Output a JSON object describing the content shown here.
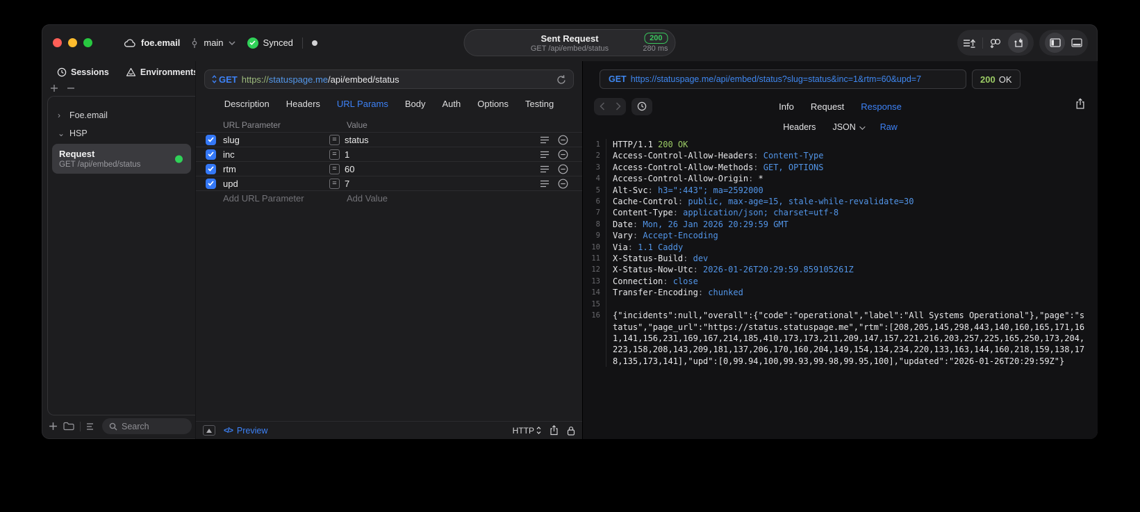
{
  "titlebar": {
    "project": "foe.email",
    "branch": "main",
    "sync_status": "Synced",
    "request_title": "Sent Request",
    "request_subtitle": "GET /api/embed/status",
    "status_code": "200",
    "duration": "280 ms"
  },
  "sidebar": {
    "tabs": [
      {
        "label": "Sessions",
        "active": true
      },
      {
        "label": "Environments"
      }
    ],
    "tree": [
      {
        "chevron": "›",
        "label": "Foe.email"
      },
      {
        "chevron": "⌄",
        "label": "HSP"
      }
    ],
    "request_item": {
      "title": "Request",
      "subtitle": "GET /api/embed/status"
    },
    "search_placeholder": "Search"
  },
  "request_panel": {
    "method": "GET",
    "url_scheme": "https://",
    "url_host": "statuspage.me",
    "url_path": "/api/embed/status",
    "tabs": [
      {
        "label": "Description"
      },
      {
        "label": "Headers"
      },
      {
        "label": "URL Params",
        "active": true
      },
      {
        "label": "Body"
      },
      {
        "label": "Auth"
      },
      {
        "label": "Options"
      },
      {
        "label": "Testing"
      }
    ],
    "param_table": {
      "col_name": "URL Parameter",
      "col_value": "Value",
      "match_symbol": "=",
      "rows": [
        {
          "name": "slug",
          "value": "status",
          "enabled": true
        },
        {
          "name": "inc",
          "value": "1",
          "enabled": true
        },
        {
          "name": "rtm",
          "value": "60",
          "enabled": true
        },
        {
          "name": "upd",
          "value": "7",
          "enabled": true
        }
      ],
      "add_name_placeholder": "Add URL Parameter",
      "add_value_placeholder": "Add Value"
    },
    "footer": {
      "code_symbol": "</>",
      "preview_label": "Preview",
      "protocol": "HTTP"
    }
  },
  "response_panel": {
    "method": "GET",
    "url": "https://statuspage.me/api/embed/status?slug=status&inc=1&rtm=60&upd=7",
    "status_code": "200",
    "status_text": "OK",
    "tabs": [
      {
        "label": "Info"
      },
      {
        "label": "Request"
      },
      {
        "label": "Response",
        "active": true
      }
    ],
    "subtabs": [
      {
        "label": "Headers"
      },
      {
        "label": "JSON",
        "dropdown": true
      },
      {
        "label": "Raw",
        "active": true
      }
    ],
    "code_lines": [
      {
        "num": 1,
        "name": "HTTP/1.1",
        "sep": " ",
        "value": "200 OK",
        "value_class": "green"
      },
      {
        "num": 2,
        "name": "Access-Control-Allow-Headers",
        "sep": ": ",
        "value": "Content-Type",
        "value_class": "blue"
      },
      {
        "num": 3,
        "name": "Access-Control-Allow-Methods",
        "sep": ": ",
        "value": "GET, OPTIONS",
        "value_class": "blue"
      },
      {
        "num": 4,
        "name": "Access-Control-Allow-Origin",
        "sep": ": ",
        "value": "*",
        "value_class": "plain"
      },
      {
        "num": 5,
        "name": "Alt-Svc",
        "sep": ": ",
        "value": "h3=\":443\"; ma=2592000",
        "value_class": "blue"
      },
      {
        "num": 6,
        "name": "Cache-Control",
        "sep": ": ",
        "value": "public, max-age=15, stale-while-revalidate=30",
        "value_class": "blue"
      },
      {
        "num": 7,
        "name": "Content-Type",
        "sep": ": ",
        "value": "application/json; charset=utf-8",
        "value_class": "blue"
      },
      {
        "num": 8,
        "name": "Date",
        "sep": ": ",
        "value": "Mon, 26 Jan 2026 20:29:59 GMT",
        "value_class": "blue"
      },
      {
        "num": 9,
        "name": "Vary",
        "sep": ": ",
        "value": "Accept-Encoding",
        "value_class": "blue"
      },
      {
        "num": 10,
        "name": "Via",
        "sep": ": ",
        "value": "1.1 Caddy",
        "value_class": "blue"
      },
      {
        "num": 11,
        "name": "X-Status-Build",
        "sep": ": ",
        "value": "dev",
        "value_class": "blue"
      },
      {
        "num": 12,
        "name": "X-Status-Now-Utc",
        "sep": ": ",
        "value": "2026-01-26T20:29:59.859105261Z",
        "value_class": "blue"
      },
      {
        "num": 13,
        "name": "Connection",
        "sep": ": ",
        "value": "close",
        "value_class": "blue"
      },
      {
        "num": 14,
        "name": "Transfer-Encoding",
        "sep": ": ",
        "value": "chunked",
        "value_class": "blue"
      },
      {
        "num": 15
      },
      {
        "num": 16,
        "name": "",
        "sep": "",
        "value": "{\"incidents\":null,\"overall\":{\"code\":\"operational\",\"label\":\"All Systems Operational\"},\"page\":\"status\",\"page_url\":\"https://status.statuspage.me\",\"rtm\":[208,205,145,298,443,140,160,165,171,161,141,156,231,169,167,214,185,410,173,173,211,209,147,157,221,216,203,257,225,165,250,173,204,223,158,208,143,209,181,137,206,170,160,204,149,154,134,234,220,133,163,144,160,218,159,138,178,135,173,141],\"upd\":[0,99.94,100,99.93,99.98,99.95,100],\"updated\":\"2026-01-26T20:29:59Z\"}",
        "value_class": "plain"
      }
    ]
  },
  "colors": {
    "accent_blue": "#3d82f7",
    "success_green": "#30d158",
    "badge_green": "#3ac75e",
    "code_value_blue": "#5295e8",
    "code_green": "#9ccc65",
    "url_scheme_green": "#9dbb7d"
  }
}
